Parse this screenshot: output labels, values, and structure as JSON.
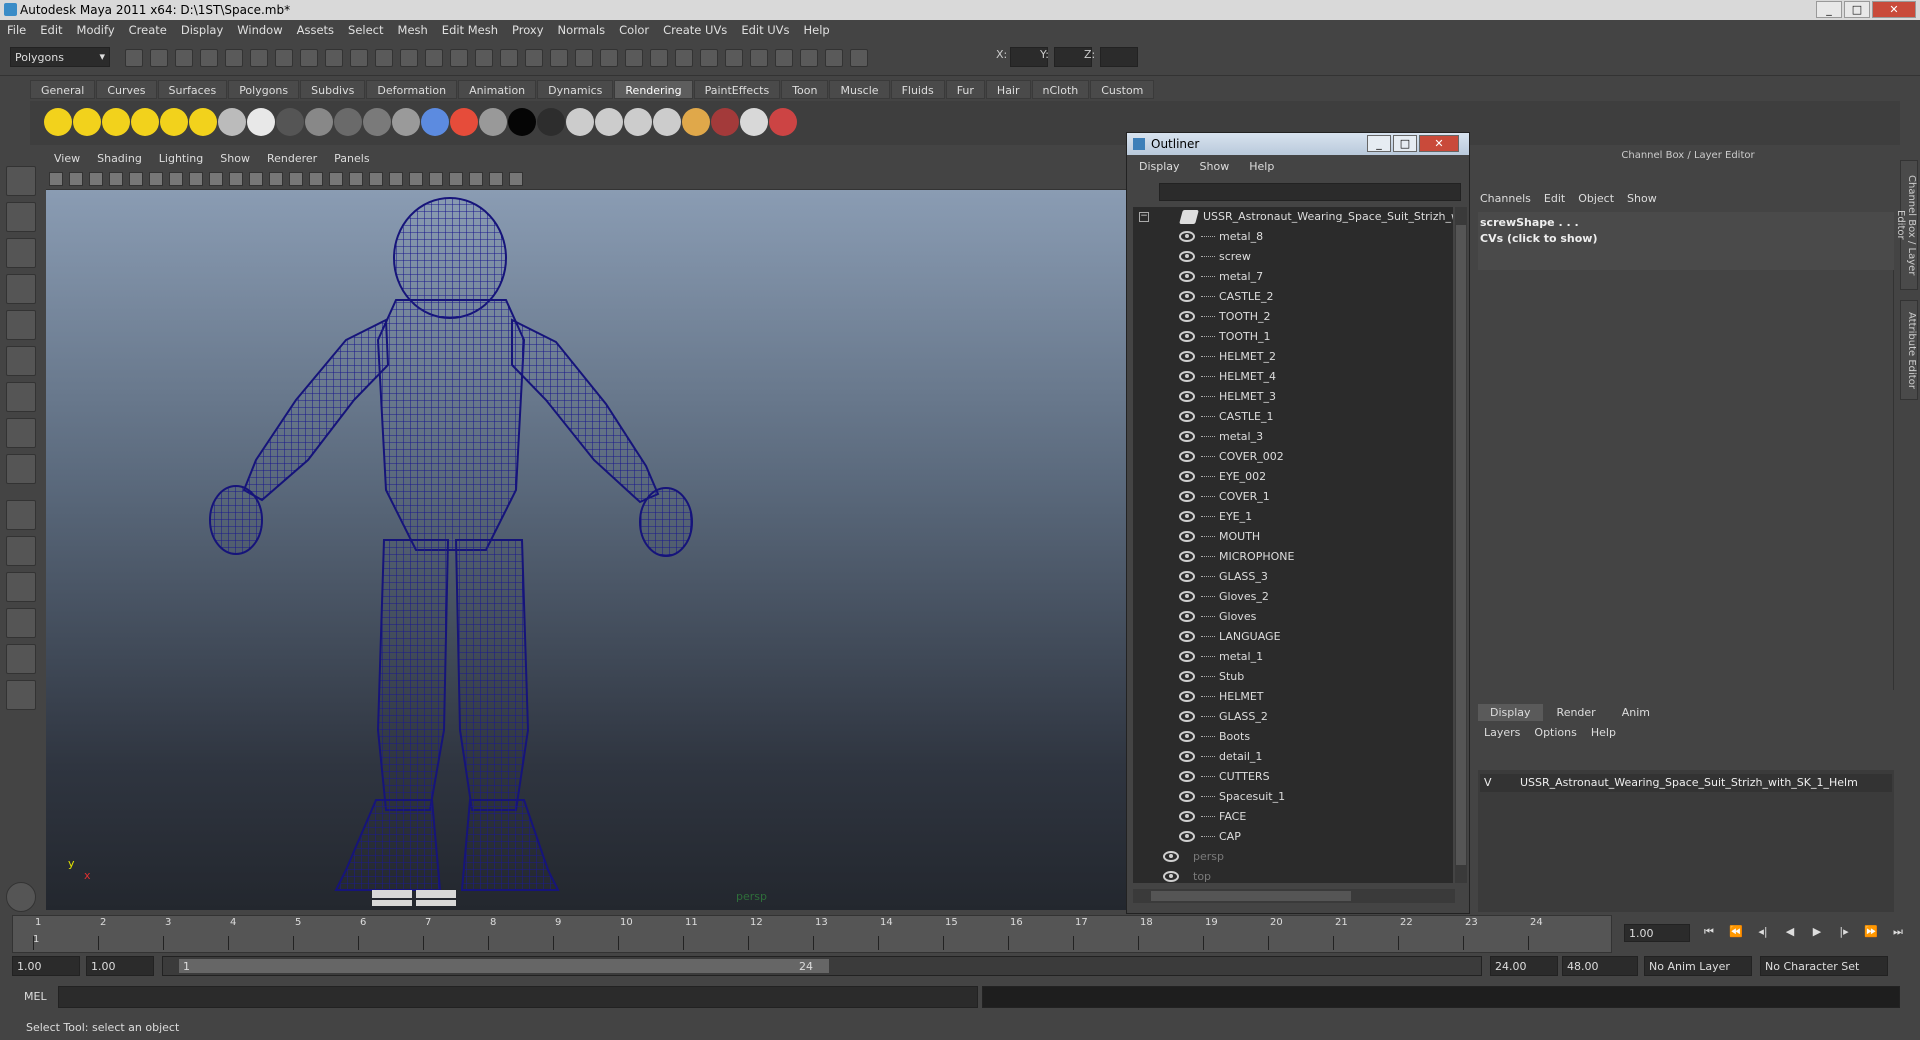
{
  "window": {
    "title": "Autodesk Maya 2011 x64: D:\\1ST\\Space.mb*",
    "controls": [
      "_",
      "□",
      "✕"
    ]
  },
  "menubar": [
    "File",
    "Edit",
    "Modify",
    "Create",
    "Display",
    "Window",
    "Assets",
    "Select",
    "Mesh",
    "Edit Mesh",
    "Proxy",
    "Normals",
    "Color",
    "Create UVs",
    "Edit UVs",
    "Help"
  ],
  "statusline": {
    "mode": "Polygons",
    "x_label": "X:",
    "y_label": "Y:",
    "z_label": "Z:"
  },
  "shelf": {
    "tabs": [
      "General",
      "Curves",
      "Surfaces",
      "Polygons",
      "Subdivs",
      "Deformation",
      "Animation",
      "Dynamics",
      "Rendering",
      "PaintEffects",
      "Toon",
      "Muscle",
      "Fluids",
      "Fur",
      "Hair",
      "nCloth",
      "Custom"
    ],
    "active_tab": "Rendering",
    "icon_colors": [
      "#f2d21c",
      "#f2d21c",
      "#f2d21c",
      "#f2d21c",
      "#f2d21c",
      "#f2d21c",
      "#bbbbbb",
      "#e8e8e8",
      "#555555",
      "#888888",
      "#6a6a6a",
      "#7a7a7a",
      "#9a9a9a",
      "#5c8be0",
      "#e64c3a",
      "#999999",
      "#050505",
      "#2d2d2d",
      "#cccccc",
      "#cccccc",
      "#cccccc",
      "#cccccc",
      "#e0a84a",
      "#a33a3a",
      "#d8d8d8",
      "#cc4444"
    ]
  },
  "viewport": {
    "menu": [
      "View",
      "Shading",
      "Lighting",
      "Show",
      "Renderer",
      "Panels"
    ],
    "camera_label": "persp",
    "axis_y": "y",
    "axis_x": "x",
    "wireframe_color": "#1c1a8c",
    "bg_top": "#8a9cb3",
    "bg_bottom": "#23272e"
  },
  "outliner": {
    "title": "Outliner",
    "menu": [
      "Display",
      "Show",
      "Help"
    ],
    "root": "USSR_Astronaut_Wearing_Space_Suit_Strizh_wit",
    "items": [
      "metal_8",
      "screw",
      "metal_7",
      "CASTLE_2",
      "TOOTH_2",
      "TOOTH_1",
      "HELMET_2",
      "HELMET_4",
      "HELMET_3",
      "CASTLE_1",
      "metal_3",
      "COVER_002",
      "EYE_002",
      "COVER_1",
      "EYE_1",
      "MOUTH",
      "MICROPHONE",
      "GLASS_3",
      "Gloves_2",
      "Gloves",
      "LANGUAGE",
      "metal_1",
      "Stub",
      "HELMET",
      "GLASS_2",
      "Boots",
      "detail_1",
      "CUTTERS",
      "Spacesuit_1",
      "FACE",
      "CAP"
    ],
    "cameras": [
      "persp",
      "top"
    ]
  },
  "channel_box": {
    "title": "Channel Box / Layer Editor",
    "menu": [
      "Channels",
      "Edit",
      "Object",
      "Show"
    ],
    "shape_name": "screwShape . . .",
    "cvs": "CVs (click to show)",
    "side_tabs": [
      "Channel Box / Layer Editor",
      "Attribute Editor"
    ]
  },
  "layers": {
    "tabs": [
      "Display",
      "Render",
      "Anim"
    ],
    "active_tab": "Display",
    "menu": [
      "Layers",
      "Options",
      "Help"
    ],
    "rows": [
      {
        "visible": "V",
        "name": "USSR_Astronaut_Wearing_Space_Suit_Strizh_with_SK_1_Helm"
      }
    ]
  },
  "timeline": {
    "ticks": [
      "1",
      "2",
      "3",
      "4",
      "5",
      "6",
      "7",
      "8",
      "9",
      "10",
      "11",
      "12",
      "13",
      "14",
      "15",
      "16",
      "17",
      "18",
      "19",
      "20",
      "21",
      "22",
      "23",
      "24"
    ],
    "start_marker": "1",
    "current_frame": "1.00",
    "playback_buttons": [
      "⏮",
      "⏪",
      "◂|",
      "◀",
      "▶",
      "|▸",
      "⏩",
      "⏭"
    ]
  },
  "range": {
    "start": "1.00",
    "start2": "1.00",
    "slider_start": "1",
    "slider_end": "24",
    "end": "24.00",
    "end2": "48.00",
    "anim_layer": "No Anim Layer",
    "char_set": "No Character Set"
  },
  "command": {
    "label": "MEL"
  },
  "helpline": "Select Tool: select an object"
}
